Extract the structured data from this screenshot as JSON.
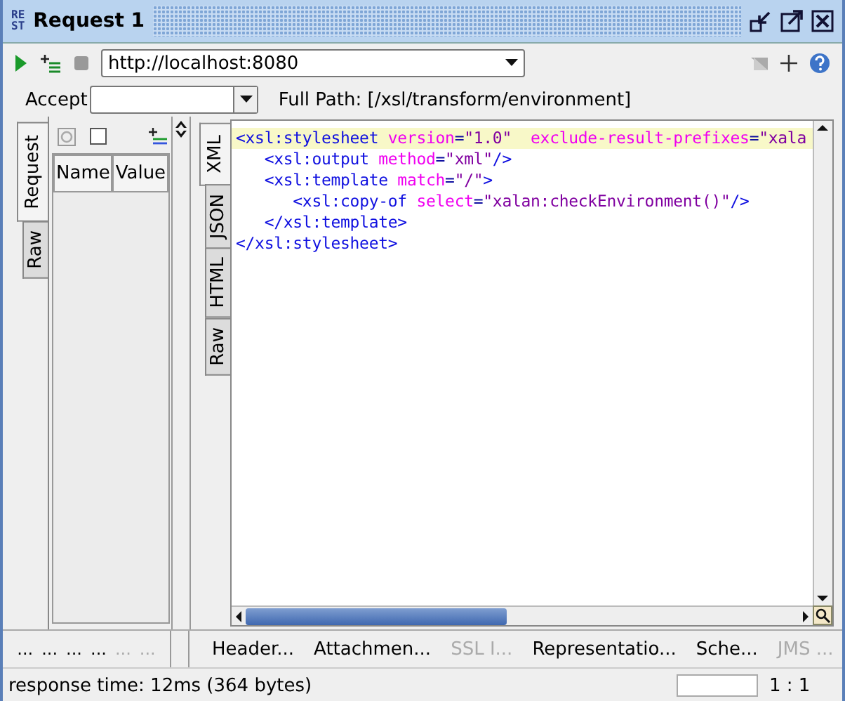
{
  "window": {
    "logo": [
      "RE",
      "ST"
    ],
    "title": "Request 1"
  },
  "toolbar": {
    "url": "http://localhost:8080"
  },
  "accept": {
    "label": "Accept",
    "full_path": "Full Path: [/xsl/transform/environment]"
  },
  "request_tabs": [
    {
      "label": "Request",
      "selected": true
    },
    {
      "label": "Raw",
      "selected": false
    }
  ],
  "params_table": {
    "columns": [
      "Name",
      "Value"
    ]
  },
  "left_bottom_tabs": [
    {
      "label": "...",
      "disabled": false
    },
    {
      "label": "...",
      "disabled": false
    },
    {
      "label": "...",
      "disabled": false
    },
    {
      "label": "...",
      "disabled": false
    },
    {
      "label": "...",
      "disabled": true
    },
    {
      "label": "...",
      "disabled": true
    }
  ],
  "response_tabs": [
    {
      "label": "XML",
      "selected": true
    },
    {
      "label": "JSON",
      "selected": false
    },
    {
      "label": "HTML",
      "selected": false
    },
    {
      "label": "Raw",
      "selected": false
    }
  ],
  "code_lines": [
    {
      "current": true,
      "tokens": [
        {
          "kind": "tag",
          "text": "<xsl:stylesheet"
        },
        {
          "kind": "attr",
          "text": " version"
        },
        {
          "kind": "eq",
          "text": "="
        },
        {
          "kind": "value",
          "text": "\"1.0\""
        },
        {
          "kind": "attr",
          "text": "  exclude-result-prefixes"
        },
        {
          "kind": "eq",
          "text": "="
        },
        {
          "kind": "value",
          "text": "\"xala"
        }
      ],
      "children": [
        {
          "current": false,
          "tokens": [
            {
              "kind": "tag",
              "text": "<xsl:output"
            },
            {
              "kind": "attr",
              "text": " method"
            },
            {
              "kind": "eq",
              "text": "="
            },
            {
              "kind": "value",
              "text": "\"xml\""
            },
            {
              "kind": "tag",
              "text": "/>"
            }
          ]
        },
        {
          "current": false,
          "tokens": [
            {
              "kind": "tag",
              "text": "<xsl:template"
            },
            {
              "kind": "attr",
              "text": " match"
            },
            {
              "kind": "eq",
              "text": "="
            },
            {
              "kind": "value",
              "text": "\"/\""
            },
            {
              "kind": "tag",
              "text": ">"
            }
          ],
          "children": [
            {
              "current": false,
              "tokens": [
                {
                  "kind": "tag",
                  "text": "<xsl:copy-of"
                },
                {
                  "kind": "attr",
                  "text": " select"
                },
                {
                  "kind": "eq",
                  "text": "="
                },
                {
                  "kind": "value",
                  "text": "\"xalan:checkEnvironment()\""
                },
                {
                  "kind": "tag",
                  "text": "/>"
                }
              ]
            }
          ]
        },
        {
          "current": false,
          "tokens": [
            {
              "kind": "tag",
              "text": "</xsl:template>"
            }
          ]
        }
      ]
    },
    {
      "current": false,
      "tokens": [
        {
          "kind": "tag",
          "text": "</xsl:stylesheet>"
        }
      ]
    }
  ],
  "bottom_tabs": [
    {
      "label": "Header...",
      "disabled": false
    },
    {
      "label": "Attachmen...",
      "disabled": false
    },
    {
      "label": "SSL I...",
      "disabled": true
    },
    {
      "label": "Representatio...",
      "disabled": false
    },
    {
      "label": "Sche...",
      "disabled": false
    },
    {
      "label": "JMS ...",
      "disabled": true
    }
  ],
  "status_bar": {
    "text": "response time: 12ms (364 bytes)",
    "position": "1 : 1"
  }
}
